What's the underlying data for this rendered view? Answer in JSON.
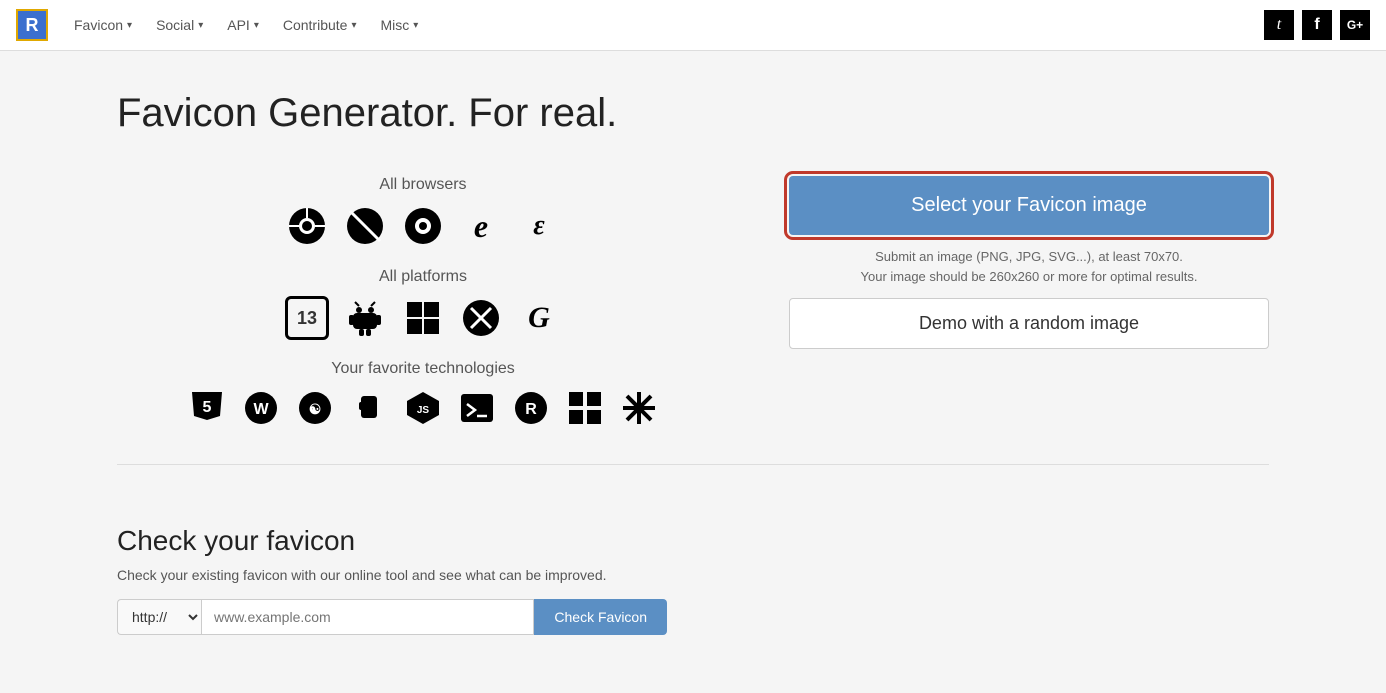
{
  "nav": {
    "logo_letter": "R",
    "items": [
      {
        "label": "Favicon",
        "has_dropdown": true
      },
      {
        "label": "Social",
        "has_dropdown": true
      },
      {
        "label": "API",
        "has_dropdown": true
      },
      {
        "label": "Contribute",
        "has_dropdown": true
      },
      {
        "label": "Misc",
        "has_dropdown": true
      }
    ],
    "social": [
      {
        "name": "twitter",
        "symbol": "t"
      },
      {
        "name": "facebook",
        "symbol": "f"
      },
      {
        "name": "google-plus",
        "symbol": "G+"
      }
    ]
  },
  "hero": {
    "title": "Favicon Generator. For real."
  },
  "browsers": {
    "label": "All browsers",
    "icons": [
      "⊗",
      "⊘",
      "🔥",
      "e",
      "ε"
    ]
  },
  "platforms": {
    "label": "All platforms",
    "icons": [
      "13",
      "🤖",
      "⊞",
      "✕",
      "G"
    ]
  },
  "technologies": {
    "label": "Your favorite technologies",
    "icons": [
      "5",
      "W",
      "♥",
      "☕",
      "⬡",
      "▶",
      "R",
      "⊞",
      "✳"
    ]
  },
  "actions": {
    "select_favicon_label": "Select your Favicon image",
    "hint_line1": "Submit an image (PNG, JPG, SVG...), at least 70x70.",
    "hint_line2": "Your image should be 260x260 or more for optimal results.",
    "demo_label": "Demo with a random image"
  },
  "check_favicon": {
    "title": "Check your favicon",
    "description": "Check your existing favicon with our online tool and see what can be improved.",
    "protocol_default": "http://",
    "url_placeholder": "www.example.com",
    "button_label": "Check Favicon"
  }
}
